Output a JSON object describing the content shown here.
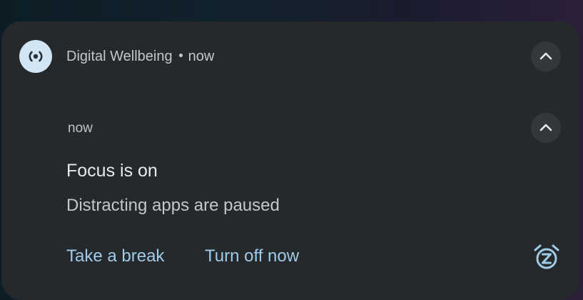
{
  "notification_group": {
    "app_name": "Digital Wellbeing",
    "time": "now",
    "app_icon": "digital-wellbeing-icon",
    "collapse_icon": "chevron-up-icon"
  },
  "notification": {
    "time": "now",
    "title": "Focus is on",
    "text": "Distracting apps are paused",
    "collapse_icon": "chevron-up-icon",
    "actions": [
      {
        "label": "Take a break"
      },
      {
        "label": "Turn off now"
      }
    ],
    "snooze_icon": "snooze-alarm-icon"
  },
  "colors": {
    "card_background": "#25292c",
    "accent": "#9fcbe8",
    "icon_background": "#d3e4f2"
  }
}
